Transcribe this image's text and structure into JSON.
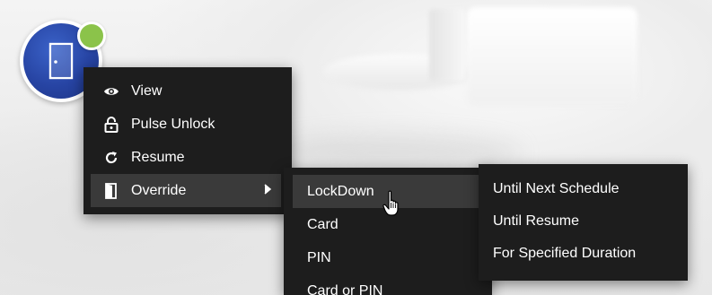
{
  "device": {
    "icon": "door-icon",
    "status": "online",
    "status_color": "#8bc34a",
    "badge_color": "#2744a3"
  },
  "context_menu": {
    "items": [
      {
        "label": "View",
        "icon": "eye-icon"
      },
      {
        "label": "Pulse Unlock",
        "icon": "padlock-icon"
      },
      {
        "label": "Resume",
        "icon": "refresh-icon"
      },
      {
        "label": "Override",
        "icon": "door-open-icon",
        "has_submenu": true,
        "active": true
      }
    ]
  },
  "override_menu": {
    "items": [
      {
        "label": "LockDown",
        "active": true
      },
      {
        "label": "Card"
      },
      {
        "label": "PIN"
      },
      {
        "label": "Card or PIN"
      }
    ]
  },
  "lockdown_menu": {
    "items": [
      {
        "label": "Until Next Schedule"
      },
      {
        "label": "Until Resume"
      },
      {
        "label": "For Specified Duration"
      }
    ]
  },
  "colors": {
    "menu_bg": "#1d1d1d",
    "menu_highlight": "#3a3a3a",
    "menu_text": "#ffffff"
  }
}
